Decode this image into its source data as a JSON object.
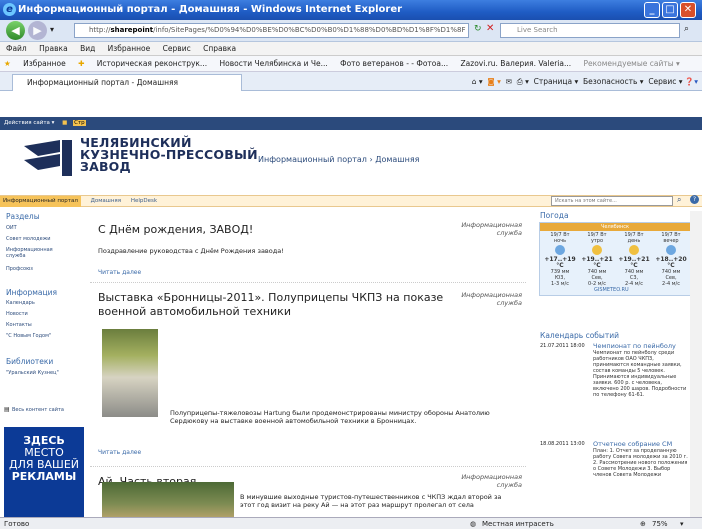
{
  "window": {
    "title": "Информационный портал - Домашняя - Windows Internet Explorer"
  },
  "address": {
    "url_prefix": "http://",
    "url_host": "sharepoint",
    "url_rest": "/info/SitePages/%D0%94%D0%BE%D0%BC%D0%B0%D1%88%D0%BD%D1%8F%D1%8F",
    "search_placeholder": "Live Search"
  },
  "menu": [
    "Файл",
    "Правка",
    "Вид",
    "Избранное",
    "Сервис",
    "Справка"
  ],
  "favorites": {
    "label": "Избранное",
    "items": [
      "Историческая реконструк...",
      "Новости Челябинска и Че...",
      "Фото ветеранов - - Фотоа...",
      "Zazovi.ru. Валерия. Valeria...",
      "Рекомендуемые сайты ▾"
    ]
  },
  "tab": {
    "title": "Информационный портал - Домашняя"
  },
  "tools": {
    "page": "Страница ▾",
    "security": "Безопасность ▾",
    "service": "Сервис ▾"
  },
  "sp_bar": {
    "actions": "Действия сайта ▾",
    "edit": "Стр"
  },
  "org": {
    "line1": "ЧЕЛЯБИНСКИЙ",
    "line2": "КУЗНЕЧНО-ПРЕССОВЫЙ",
    "line3": "ЗАВОД",
    "crumb": "Информационный портал › Домашняя"
  },
  "navstrip": {
    "selected": "Информационный портал",
    "items": [
      "Домашняя",
      "HelpDesk"
    ],
    "search_placeholder": "Искать на этом сайте..."
  },
  "sidebar": {
    "sections_head": "Разделы",
    "sections": [
      "ОИТ",
      "Совет молодежи",
      "Информационная служба",
      "Профсоюз"
    ],
    "info_head": "Информация",
    "info": [
      "Календарь",
      "Новости",
      "Контакты",
      "\"С Новым Годом\""
    ],
    "lib_head": "Библиотеки",
    "lib": [
      "\"Уральский Кузнец\""
    ],
    "all": "Весь контент сайта"
  },
  "ad": {
    "l1": "ЗДЕСЬ",
    "l2": "МЕСТО",
    "l3": "ДЛЯ ВАШЕЙ",
    "l4": "РЕКЛАМЫ"
  },
  "posts": [
    {
      "title": "С Днём рождения, ЗАВОД!",
      "author": "Информационная служба",
      "text": "Поздравление руководства с Днём Рождения завода!",
      "more": "Читать далее"
    },
    {
      "title": "Выставка «Бронницы-2011». Полуприцепы ЧКПЗ на показе военной автомобильной техники",
      "author": "Информационная служба",
      "text": "Полуприцепы-тяжеловозы Hartung были продемонстрированы министру обороны Анатолию Сердюкову на выставке военной автомобильной техники в Бронницах.",
      "more": "Читать далее"
    },
    {
      "title": "Ай. Часть вторая",
      "author": "Информационная служба",
      "text": "В минувшие выходные туристов-путешественников с ЧКПЗ ждал второй за этот год визит на реку Ай — на этот раз маршрут пролегал от села"
    }
  ],
  "weather": {
    "head": "Погода",
    "city": "Челябинск",
    "cols": [
      {
        "date": "19/7 Вт",
        "part": "ночь",
        "temp": "+17..+19 °C",
        "p": "739 мм",
        "w": "Ю3,",
        "s": "1-3 м/с"
      },
      {
        "date": "19/7 Вт",
        "part": "утро",
        "temp": "+19..+21 °C",
        "p": "740 мм",
        "w": "Сев,",
        "s": "0-2 м/с"
      },
      {
        "date": "19/7 Вт",
        "part": "день",
        "temp": "+19..+21 °C",
        "p": "740 мм",
        "w": "С3,",
        "s": "2-4 м/с"
      },
      {
        "date": "19/7 Вт",
        "part": "вечер",
        "temp": "+18..+20 °C",
        "p": "740 мм",
        "w": "Сев,",
        "s": "2-4 м/с"
      }
    ],
    "brand": "GISMETEO.RU"
  },
  "calendar": {
    "head": "Календарь событий",
    "events": [
      {
        "date": "21.07.2011 18:00",
        "title": "Чемпионат по пейнболу",
        "desc": "Чемпионат по пейнболу среди работников ОАО ЧКПЗ, принимаются командные заявки, состав команды 5 человек. Принимаются индивидуальные заявки. 600 р. с человека, включено 200 шаров. Подробности по телефону 61-61."
      },
      {
        "date": "18.08.2011 13:00",
        "title": "Отчетное собрание СМ",
        "desc": "План: 1. Отчет за проделанную работу Совета молодежи за 2010 г. 2. Рассмотрение нового положения о Совете Молодежи 3. Выбор членов Совета Молодежи"
      }
    ]
  },
  "status": {
    "left": "Готово",
    "zone": "Местная интрасеть",
    "zoom": "75%"
  }
}
